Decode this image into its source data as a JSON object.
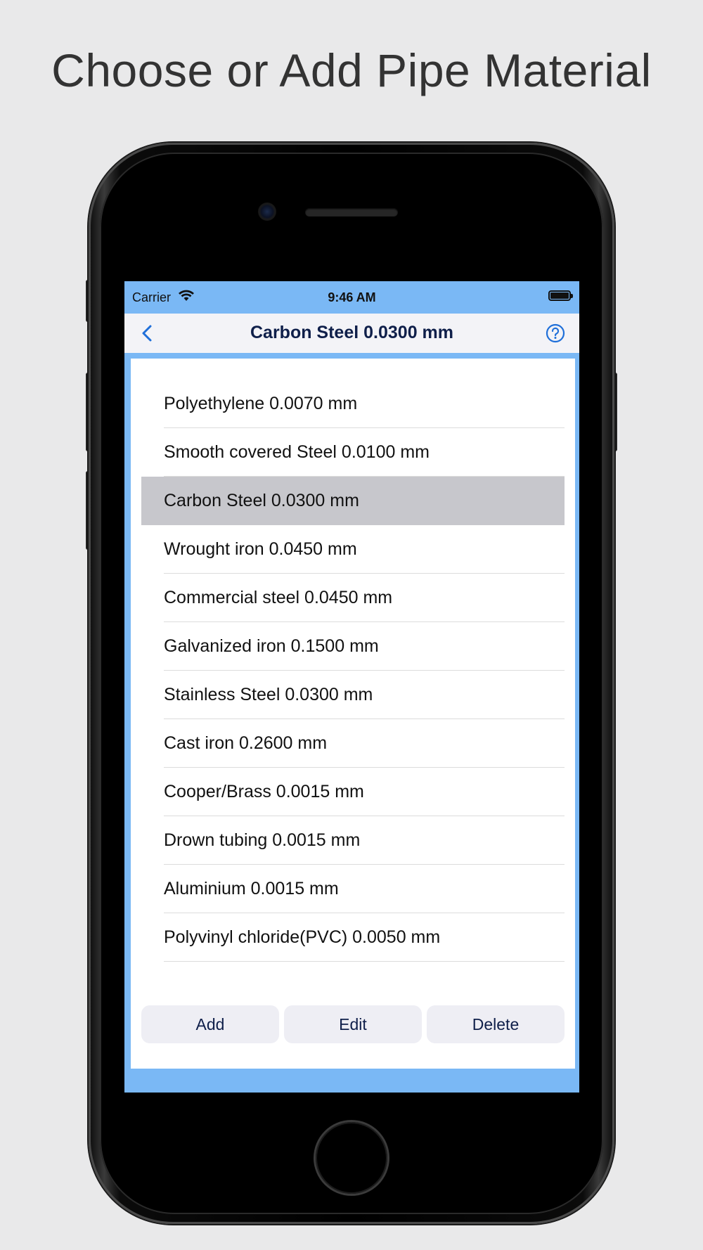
{
  "headline": "Choose or Add Pipe Material",
  "status_bar": {
    "carrier": "Carrier",
    "time": "9:46 AM"
  },
  "nav": {
    "title": "Carbon Steel 0.0300 mm",
    "back_icon": "chevron-left-icon",
    "help_icon": "question-circle-icon"
  },
  "materials": [
    {
      "label": "Polyethylene 0.0070 mm",
      "selected": false
    },
    {
      "label": "Smooth covered Steel 0.0100 mm",
      "selected": false
    },
    {
      "label": "Carbon Steel 0.0300 mm",
      "selected": true
    },
    {
      "label": "Wrought iron 0.0450 mm",
      "selected": false
    },
    {
      "label": "Commercial steel 0.0450 mm",
      "selected": false
    },
    {
      "label": "Galvanized iron 0.1500 mm",
      "selected": false
    },
    {
      "label": "Stainless Steel 0.0300 mm",
      "selected": false
    },
    {
      "label": "Cast iron 0.2600 mm",
      "selected": false
    },
    {
      "label": "Cooper/Brass 0.0015 mm",
      "selected": false
    },
    {
      "label": "Drown tubing 0.0015 mm",
      "selected": false
    },
    {
      "label": "Aluminium 0.0015 mm",
      "selected": false
    },
    {
      "label": "Polyvinyl chloride(PVC) 0.0050 mm",
      "selected": false
    }
  ],
  "actions": {
    "add_label": "Add",
    "edit_label": "Edit",
    "delete_label": "Delete"
  },
  "colors": {
    "accent": "#1f6fd9",
    "screen_background": "#7ab8f5",
    "selected_row": "#c7c7cc",
    "title_text": "#0f1f4a"
  }
}
